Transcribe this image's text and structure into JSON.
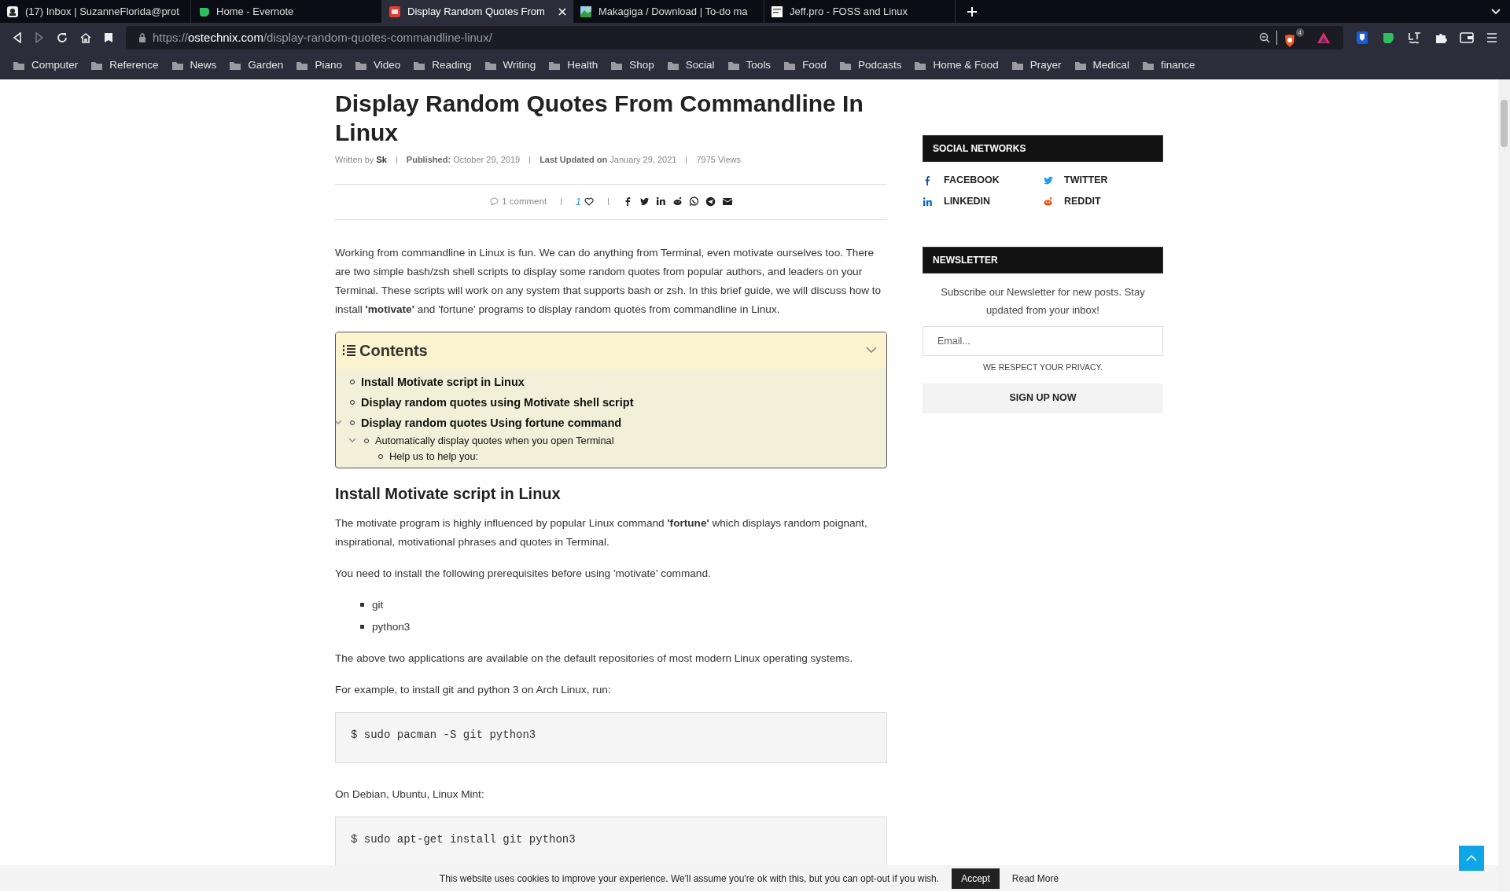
{
  "browser": {
    "tabs": [
      {
        "title": "(17) Inbox | SuzanneFlorida@prot",
        "selected": false
      },
      {
        "title": "Home - Evernote",
        "selected": false
      },
      {
        "title": "Display Random Quotes From",
        "selected": true
      },
      {
        "title": "Makagiga / Download | To-do ma",
        "selected": false
      },
      {
        "title": "Jeff.pro - FOSS and Linux",
        "selected": false
      }
    ],
    "address": {
      "scheme": "https://",
      "domain": "ostechnix.com",
      "path": "/display-random-quotes-commandline-linux/"
    },
    "shield_badge": "4",
    "bookmarks": [
      "Computer",
      "Reference",
      "News",
      "Garden",
      "Piano",
      "Video",
      "Reading",
      "Writing",
      "Health",
      "Shop",
      "Social",
      "Tools",
      "Food",
      "Podcasts",
      "Home & Food",
      "Prayer",
      "Medical",
      "finance"
    ]
  },
  "article": {
    "title": "Display Random Quotes From Commandline In Linux",
    "meta": {
      "written_by_label": "Written by",
      "author": "Sk",
      "published_label": "Published:",
      "published": "October 29, 2019",
      "updated_label": "Last Updated on",
      "updated": "January 29, 2021",
      "views": "7975 Views"
    },
    "share": {
      "comments": "1 comment",
      "likes": "1"
    },
    "blocks": [
      {
        "kind": "paragraph",
        "text": "Working from commandline in Linux is fun. We can do anything from Terminal, even motivate ourselves too. There are two simple bash/zsh shell scripts to display some random quotes from popular authors, and leaders on your Terminal. These scripts will work on any system that supports bash or zsh. In this brief guide, we will discuss how to install **'motivate'** and 'fortune' programs to display random quotes from commandline in Linux."
      },
      {
        "kind": "toc",
        "title": "Contents",
        "expanded": true,
        "items": [
          {
            "text": "Install Motivate script in Linux",
            "expanded": false
          },
          {
            "text": "Display random quotes using Motivate shell script",
            "expanded": false
          },
          {
            "text": "Display random quotes Using fortune command",
            "expanded": true,
            "children": [
              {
                "text": "Automatically display quotes when you open Terminal",
                "expanded": true,
                "children": [
                  {
                    "text": "Help us to help you:",
                    "expanded": false
                  }
                ]
              }
            ]
          }
        ]
      },
      {
        "kind": "heading",
        "text": "Install Motivate script in Linux"
      },
      {
        "kind": "paragraph",
        "text": "The motivate program is highly influenced by popular Linux command **'fortune'** which displays random poignant, inspirational, motivational phrases and quotes in Terminal."
      },
      {
        "kind": "paragraph",
        "text": "You need to install the following prerequisites before using 'motivate' command."
      },
      {
        "kind": "list",
        "items": [
          "git",
          "python3"
        ]
      },
      {
        "kind": "paragraph",
        "text": "The above two applications are available on the default repositories of most modern Linux operating systems."
      },
      {
        "kind": "paragraph",
        "text": "For example, to install git and python 3 on Arch Linux, run:"
      },
      {
        "kind": "code",
        "text": "$ sudo pacman -S git python3"
      },
      {
        "kind": "paragraph",
        "text": "On Debian, Ubuntu, Linux Mint:"
      },
      {
        "kind": "code",
        "text": "$ sudo apt-get install git python3"
      }
    ]
  },
  "sidebar": {
    "social": {
      "title": "SOCIAL NETWORKS",
      "links": [
        {
          "kind": "facebook",
          "label": "FACEBOOK"
        },
        {
          "kind": "twitter",
          "label": "TWITTER"
        },
        {
          "kind": "linkedin",
          "label": "LINKEDIN"
        },
        {
          "kind": "reddit",
          "label": "REDDIT"
        }
      ]
    },
    "newsletter": {
      "title": "NEWSLETTER",
      "text": "Subscribe our Newsletter for new posts. Stay updated from your inbox!",
      "placeholder": "Email...",
      "privacy": "WE RESPECT YOUR PRIVACY.",
      "button": "SIGN UP NOW"
    }
  },
  "cookie_bar": {
    "text": "This website uses cookies to improve your experience. We'll assume you're ok with this, but you can opt-out if you wish.",
    "accept": "Accept",
    "read_more": "Read More"
  }
}
